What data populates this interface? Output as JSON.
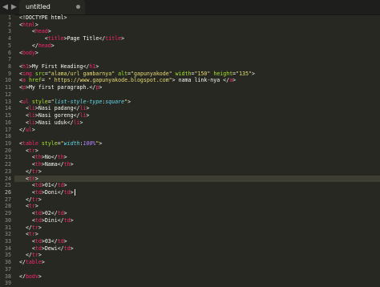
{
  "window": {
    "tab_title": "untitled",
    "back_icon": "triangle-left-icon",
    "forward_icon": "triangle-right-icon"
  },
  "editor": {
    "active_line": 24,
    "line_numbers": [
      "1",
      "2",
      "3",
      "4",
      "5",
      "6",
      "7",
      "8",
      "9",
      "10",
      "11",
      "12",
      "13",
      "14",
      "15",
      "16",
      "17",
      "18",
      "19",
      "20",
      "21",
      "22",
      "23",
      "24",
      "25",
      "26",
      "27",
      "28",
      "29",
      "30",
      "31",
      "32",
      "33",
      "34",
      "35",
      "36",
      "37",
      "38",
      "39"
    ],
    "lines": [
      [
        [
          "t",
          "<!DOCTYPE html>"
        ]
      ],
      [
        [
          "p",
          "<"
        ],
        [
          "g",
          "html"
        ],
        [
          "p",
          ">"
        ]
      ],
      [
        [
          "w",
          "    "
        ],
        [
          "p",
          "<"
        ],
        [
          "g",
          "head"
        ],
        [
          "p",
          ">"
        ]
      ],
      [
        [
          "w",
          "        "
        ],
        [
          "p",
          "<"
        ],
        [
          "g",
          "title"
        ],
        [
          "p",
          ">"
        ],
        [
          "t",
          "Page Title"
        ],
        [
          "p",
          "</"
        ],
        [
          "g",
          "title"
        ],
        [
          "p",
          ">"
        ]
      ],
      [
        [
          "w",
          "    "
        ],
        [
          "p",
          "</"
        ],
        [
          "g",
          "head"
        ],
        [
          "p",
          ">"
        ]
      ],
      [
        [
          "p",
          "<"
        ],
        [
          "g",
          "body"
        ],
        [
          "p",
          ">"
        ]
      ],
      [],
      [
        [
          "p",
          "<"
        ],
        [
          "g",
          "h1"
        ],
        [
          "p",
          ">"
        ],
        [
          "t",
          "My First Heading"
        ],
        [
          "p",
          "</"
        ],
        [
          "g",
          "h1"
        ],
        [
          "p",
          ">"
        ]
      ],
      [
        [
          "p",
          "<"
        ],
        [
          "g",
          "img"
        ],
        [
          "t",
          " "
        ],
        [
          "a",
          "src"
        ],
        [
          "p",
          "="
        ],
        [
          "s",
          "\"alama/url gambarnya\""
        ],
        [
          "t",
          " "
        ],
        [
          "a",
          "alt"
        ],
        [
          "p",
          "="
        ],
        [
          "s",
          "\"gapunyakode\""
        ],
        [
          "t",
          " "
        ],
        [
          "a",
          "width"
        ],
        [
          "p",
          "="
        ],
        [
          "s",
          "\"150\""
        ],
        [
          "t",
          " "
        ],
        [
          "a",
          "height"
        ],
        [
          "p",
          "="
        ],
        [
          "s",
          "\"135\""
        ],
        [
          "p",
          ">"
        ]
      ],
      [
        [
          "p",
          "<"
        ],
        [
          "g",
          "a"
        ],
        [
          "t",
          " "
        ],
        [
          "a",
          "href"
        ],
        [
          "p",
          "="
        ],
        [
          "t",
          " "
        ],
        [
          "s",
          "\" https://www.gapunyakode.blogspot.com\""
        ],
        [
          "p",
          ">"
        ],
        [
          "t",
          " nama link-nya "
        ],
        [
          "p",
          "</"
        ],
        [
          "g",
          "a"
        ],
        [
          "p",
          ">"
        ]
      ],
      [
        [
          "p",
          "<"
        ],
        [
          "g",
          "p"
        ],
        [
          "p",
          ">"
        ],
        [
          "t",
          "My first paragraph."
        ],
        [
          "p",
          "</"
        ],
        [
          "g",
          "p"
        ],
        [
          "p",
          ">"
        ]
      ],
      [],
      [
        [
          "p",
          "<"
        ],
        [
          "g",
          "ul"
        ],
        [
          "t",
          " "
        ],
        [
          "a",
          "style"
        ],
        [
          "p",
          "="
        ],
        [
          "s",
          "\""
        ],
        [
          "k",
          "list-style-type"
        ],
        [
          "p",
          ":"
        ],
        [
          "k",
          "square"
        ],
        [
          "s",
          "\""
        ],
        [
          "p",
          ">"
        ]
      ],
      [
        [
          "w",
          "  "
        ],
        [
          "p",
          "<"
        ],
        [
          "g",
          "li"
        ],
        [
          "p",
          ">"
        ],
        [
          "t",
          "Nasi padang"
        ],
        [
          "p",
          "</"
        ],
        [
          "g",
          "li"
        ],
        [
          "p",
          ">"
        ]
      ],
      [
        [
          "w",
          "  "
        ],
        [
          "p",
          "<"
        ],
        [
          "g",
          "li"
        ],
        [
          "p",
          ">"
        ],
        [
          "t",
          "Nasi goreng"
        ],
        [
          "p",
          "</"
        ],
        [
          "g",
          "li"
        ],
        [
          "p",
          ">"
        ]
      ],
      [
        [
          "w",
          "  "
        ],
        [
          "p",
          "<"
        ],
        [
          "g",
          "li"
        ],
        [
          "p",
          ">"
        ],
        [
          "t",
          "Nasi uduk"
        ],
        [
          "p",
          "</"
        ],
        [
          "g",
          "li"
        ],
        [
          "p",
          ">"
        ]
      ],
      [
        [
          "p",
          "</"
        ],
        [
          "g",
          "ul"
        ],
        [
          "p",
          ">"
        ]
      ],
      [],
      [
        [
          "p",
          "<"
        ],
        [
          "g",
          "table"
        ],
        [
          "t",
          " "
        ],
        [
          "a",
          "style"
        ],
        [
          "p",
          "="
        ],
        [
          "s",
          "\""
        ],
        [
          "k",
          "width"
        ],
        [
          "p",
          ":"
        ],
        [
          "n",
          "100%"
        ],
        [
          "s",
          "\""
        ],
        [
          "p",
          ">"
        ]
      ],
      [
        [
          "w",
          "  "
        ],
        [
          "p",
          "<"
        ],
        [
          "g",
          "tr"
        ],
        [
          "p",
          ">"
        ]
      ],
      [
        [
          "w",
          "    "
        ],
        [
          "p",
          "<"
        ],
        [
          "g",
          "th"
        ],
        [
          "p",
          ">"
        ],
        [
          "t",
          "No"
        ],
        [
          "p",
          "</"
        ],
        [
          "g",
          "th"
        ],
        [
          "p",
          ">"
        ]
      ],
      [
        [
          "w",
          "    "
        ],
        [
          "p",
          "<"
        ],
        [
          "g",
          "th"
        ],
        [
          "p",
          ">"
        ],
        [
          "t",
          "Nama"
        ],
        [
          "p",
          "</"
        ],
        [
          "g",
          "th"
        ],
        [
          "p",
          ">"
        ]
      ],
      [
        [
          "w",
          "  "
        ],
        [
          "p",
          "</"
        ],
        [
          "g",
          "tr"
        ],
        [
          "p",
          ">"
        ]
      ],
      [
        [
          "w",
          "  "
        ],
        [
          "p",
          "<"
        ],
        [
          "g",
          "tr"
        ],
        [
          "p",
          ">"
        ]
      ],
      [
        [
          "w",
          "    "
        ],
        [
          "p",
          "<"
        ],
        [
          "g",
          "td"
        ],
        [
          "p",
          ">"
        ],
        [
          "t",
          "01"
        ],
        [
          "p",
          "</"
        ],
        [
          "g",
          "td"
        ],
        [
          "p",
          ">"
        ]
      ],
      [
        [
          "w",
          "    "
        ],
        [
          "p",
          "<"
        ],
        [
          "g",
          "td"
        ],
        [
          "p",
          ">"
        ],
        [
          "t",
          "Doni"
        ],
        [
          "p",
          "</"
        ],
        [
          "g",
          "td"
        ],
        [
          "p",
          ">"
        ],
        [
          "c",
          ""
        ]
      ],
      [
        [
          "w",
          "  "
        ],
        [
          "p",
          "</"
        ],
        [
          "g",
          "tr"
        ],
        [
          "p",
          ">"
        ]
      ],
      [
        [
          "w",
          "  "
        ],
        [
          "p",
          "<"
        ],
        [
          "g",
          "tr"
        ],
        [
          "p",
          ">"
        ]
      ],
      [
        [
          "w",
          "    "
        ],
        [
          "p",
          "<"
        ],
        [
          "g",
          "td"
        ],
        [
          "p",
          ">"
        ],
        [
          "t",
          "02"
        ],
        [
          "p",
          "</"
        ],
        [
          "g",
          "td"
        ],
        [
          "p",
          ">"
        ]
      ],
      [
        [
          "w",
          "    "
        ],
        [
          "p",
          "<"
        ],
        [
          "g",
          "td"
        ],
        [
          "p",
          ">"
        ],
        [
          "t",
          "Dini"
        ],
        [
          "p",
          "</"
        ],
        [
          "g",
          "td"
        ],
        [
          "p",
          ">"
        ]
      ],
      [
        [
          "w",
          "  "
        ],
        [
          "p",
          "</"
        ],
        [
          "g",
          "tr"
        ],
        [
          "p",
          ">"
        ]
      ],
      [
        [
          "w",
          "  "
        ],
        [
          "p",
          "<"
        ],
        [
          "g",
          "tr"
        ],
        [
          "p",
          ">"
        ]
      ],
      [
        [
          "w",
          "    "
        ],
        [
          "p",
          "<"
        ],
        [
          "g",
          "td"
        ],
        [
          "p",
          ">"
        ],
        [
          "t",
          "03"
        ],
        [
          "p",
          "</"
        ],
        [
          "g",
          "td"
        ],
        [
          "p",
          ">"
        ]
      ],
      [
        [
          "w",
          "    "
        ],
        [
          "p",
          "<"
        ],
        [
          "g",
          "td"
        ],
        [
          "p",
          ">"
        ],
        [
          "t",
          "Dewi"
        ],
        [
          "p",
          "</"
        ],
        [
          "g",
          "td"
        ],
        [
          "p",
          ">"
        ]
      ],
      [
        [
          "w",
          "  "
        ],
        [
          "p",
          "</"
        ],
        [
          "g",
          "tr"
        ],
        [
          "p",
          ">"
        ]
      ],
      [
        [
          "p",
          "</"
        ],
        [
          "g",
          "table"
        ],
        [
          "p",
          ">"
        ]
      ],
      [],
      [
        [
          "p",
          "</"
        ],
        [
          "g",
          "body"
        ],
        [
          "p",
          ">"
        ]
      ],
      [
        [
          "p",
          "</"
        ],
        [
          "g",
          "html"
        ],
        [
          "p",
          ">"
        ]
      ]
    ]
  },
  "theme": {
    "background": "#272822",
    "tag": "#f92672",
    "attribute": "#a6e22e",
    "string": "#e6db74",
    "property": "#66d9ef",
    "number": "#ae81ff",
    "text": "#f8f8f2",
    "line_number": "#90908a"
  }
}
